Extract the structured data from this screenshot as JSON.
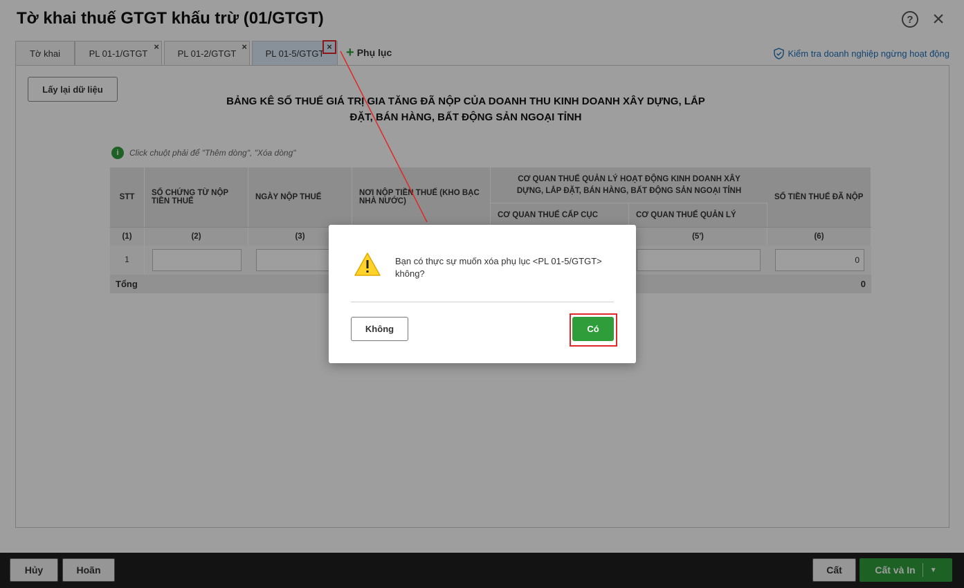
{
  "window": {
    "title": "Tờ khai thuế GTGT khấu trừ (01/GTGT)",
    "help_glyph": "?",
    "close_glyph": "×"
  },
  "tabs": [
    {
      "label": "Tờ khai",
      "closable": false
    },
    {
      "label": "PL 01-1/GTGT",
      "closable": true
    },
    {
      "label": "PL 01-2/GTGT",
      "closable": true
    },
    {
      "label": "PL 01-5/GTGT",
      "closable": true,
      "active": true
    }
  ],
  "tab_close_glyph": "×",
  "add_appendix": {
    "plus": "+",
    "label": "Phụ lục"
  },
  "check_link": "Kiểm tra doanh nghiệp ngừng hoạt động",
  "reload_button": "Lấy lại dữ liệu",
  "sheet_title_line1": "BẢNG KÊ SỐ THUẾ GIÁ TRỊ GIA TĂNG ĐÃ NỘP CỦA DOANH THU KINH DOANH XÂY DỰNG, LẮP",
  "sheet_title_line2": "ĐẶT, BÁN HÀNG, BẤT ĐỘNG SẢN NGOẠI TỈNH",
  "hint": {
    "icon": "i",
    "text": "Click chuột phải để \"Thêm dòng\", \"Xóa dòng\""
  },
  "table": {
    "headers": {
      "stt": "STT",
      "doc_no": "SỐ CHỨNG TỪ NỘP TIỀN THUẾ",
      "date": "NGÀY NỘP THUẾ",
      "place": "NƠI NỘP TIỀN THUẾ (KHO BẠC NHÀ NƯỚC)",
      "group": "CƠ QUAN THUẾ QUẢN LÝ HOẠT ĐỘNG KINH DOANH XÂY DỰNG, LẮP ĐẶT, BÁN HÀNG, BẤT ĐỘNG SẢN NGOẠI TỈNH",
      "group_sub1": "CƠ QUAN THUẾ CẤP CỤC",
      "group_sub2": "CƠ QUAN THUẾ QUẢN LÝ",
      "amount": "SỐ TIỀN THUẾ ĐÃ NỘP"
    },
    "index_row": [
      "(1)",
      "(2)",
      "(3)",
      "(5')",
      "(6)"
    ],
    "rows": [
      {
        "stt": "1",
        "amount": "0"
      }
    ],
    "total_label": "Tổng",
    "total_value": "0"
  },
  "dialog": {
    "icon": "!",
    "message": "Bạn có thực sự muốn xóa phụ lục <PL 01-5/GTGT> không?",
    "no_label": "Không",
    "yes_label": "Có"
  },
  "footer": {
    "cancel": "Hủy",
    "undo": "Hoãn",
    "save": "Cất",
    "save_print": "Cất và In",
    "caret": "▼"
  },
  "colors": {
    "accent_green": "#2f9e3a",
    "highlight_red": "#e02828",
    "link_blue": "#1d6fb8",
    "footer_bg": "#1f1f1f"
  }
}
